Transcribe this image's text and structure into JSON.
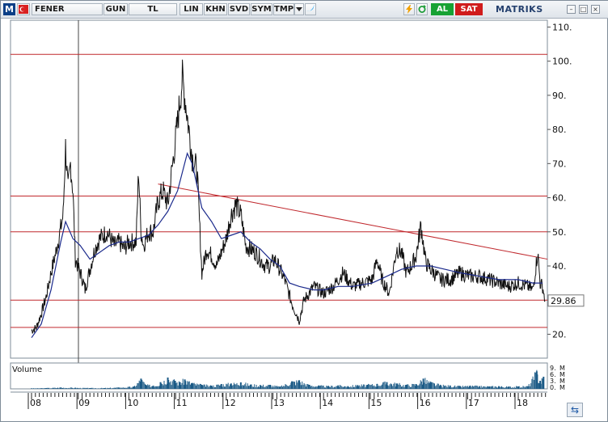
{
  "toolbar": {
    "logo": "M",
    "symbol": "FENER",
    "period": "GUN",
    "currency": "TL",
    "buttons": [
      "LIN",
      "KHN",
      "SVD",
      "SYM",
      "TMP"
    ],
    "buy": "AL",
    "sell": "SAT",
    "brand": "MATRIKS",
    "icons": [
      "flag-icon",
      "twitter-icon",
      "lightning-icon",
      "refresh-icon"
    ]
  },
  "chart_data": {
    "type": "line",
    "x_ticks": [
      "08",
      "09",
      "10",
      "11",
      "12",
      "13",
      "14",
      "15",
      "16",
      "17",
      "18"
    ],
    "y_ticks": [
      20,
      30,
      40,
      50,
      60,
      70,
      80,
      90,
      100,
      110
    ],
    "y_tick_labels": [
      "20.",
      "30.",
      "40.",
      "50.",
      "60.",
      "70.",
      "80.",
      "90.",
      "100.",
      "110."
    ],
    "ylim": [
      13,
      112
    ],
    "last_price_label": "29.86",
    "last_price": 29.86,
    "horizontal_levels": [
      22,
      30,
      50,
      60.5,
      102
    ],
    "trendline": [
      {
        "x": 10.6,
        "y": 64
      },
      {
        "x": 18.6,
        "y": 42
      }
    ],
    "price_path": [
      [
        8.0,
        21
      ],
      [
        8.1,
        22
      ],
      [
        8.2,
        26
      ],
      [
        8.3,
        31
      ],
      [
        8.4,
        38
      ],
      [
        8.5,
        44
      ],
      [
        8.6,
        51
      ],
      [
        8.65,
        55
      ],
      [
        8.7,
        75
      ],
      [
        8.75,
        62
      ],
      [
        8.8,
        70
      ],
      [
        8.85,
        62
      ],
      [
        8.9,
        42
      ],
      [
        9.0,
        38
      ],
      [
        9.05,
        36
      ],
      [
        9.1,
        33
      ],
      [
        9.2,
        39
      ],
      [
        9.3,
        45
      ],
      [
        9.4,
        48
      ],
      [
        9.55,
        50
      ],
      [
        9.7,
        46
      ],
      [
        9.8,
        47
      ],
      [
        9.9,
        45
      ],
      [
        10.0,
        47
      ],
      [
        10.15,
        47
      ],
      [
        10.2,
        68
      ],
      [
        10.25,
        50
      ],
      [
        10.3,
        46
      ],
      [
        10.4,
        50
      ],
      [
        10.5,
        50
      ],
      [
        10.6,
        59
      ],
      [
        10.7,
        62
      ],
      [
        10.8,
        58
      ],
      [
        10.9,
        70
      ],
      [
        11.0,
        82
      ],
      [
        11.1,
        95
      ],
      [
        11.2,
        84
      ],
      [
        11.3,
        72
      ],
      [
        11.4,
        68
      ],
      [
        11.5,
        38
      ],
      [
        11.6,
        45
      ],
      [
        11.7,
        43
      ],
      [
        11.8,
        40
      ],
      [
        11.9,
        44
      ],
      [
        12.0,
        48
      ],
      [
        12.1,
        55
      ],
      [
        12.2,
        58
      ],
      [
        12.3,
        55
      ],
      [
        12.4,
        46
      ],
      [
        12.5,
        45
      ],
      [
        12.6,
        44
      ],
      [
        12.7,
        42
      ],
      [
        12.8,
        40
      ],
      [
        12.9,
        40
      ],
      [
        13.0,
        42
      ],
      [
        13.2,
        36
      ],
      [
        13.35,
        29
      ],
      [
        13.5,
        24
      ],
      [
        13.6,
        30
      ],
      [
        13.8,
        34
      ],
      [
        14.0,
        32
      ],
      [
        14.2,
        34
      ],
      [
        14.4,
        38
      ],
      [
        14.6,
        34
      ],
      [
        14.8,
        35
      ],
      [
        15.0,
        36
      ],
      [
        15.1,
        42
      ],
      [
        15.2,
        36
      ],
      [
        15.35,
        32
      ],
      [
        15.5,
        45
      ],
      [
        15.6,
        44
      ],
      [
        15.7,
        38
      ],
      [
        15.8,
        40
      ],
      [
        15.9,
        43
      ],
      [
        16.0,
        52
      ],
      [
        16.1,
        41
      ],
      [
        16.2,
        39
      ],
      [
        16.4,
        36
      ],
      [
        16.6,
        36
      ],
      [
        16.8,
        38
      ],
      [
        17.0,
        37
      ],
      [
        17.2,
        37
      ],
      [
        17.4,
        36
      ],
      [
        17.6,
        35
      ],
      [
        17.8,
        34
      ],
      [
        18.0,
        35
      ],
      [
        18.2,
        34
      ],
      [
        18.3,
        33
      ],
      [
        18.4,
        44
      ],
      [
        18.45,
        35
      ],
      [
        18.5,
        34
      ],
      [
        18.55,
        29.86
      ]
    ],
    "ma_path": [
      [
        8.0,
        19
      ],
      [
        8.2,
        23
      ],
      [
        8.4,
        33
      ],
      [
        8.6,
        47
      ],
      [
        8.7,
        53
      ],
      [
        8.85,
        48
      ],
      [
        9.0,
        46
      ],
      [
        9.2,
        42
      ],
      [
        9.4,
        44
      ],
      [
        9.6,
        46
      ],
      [
        9.8,
        47
      ],
      [
        10.0,
        47
      ],
      [
        10.2,
        48
      ],
      [
        10.4,
        49
      ],
      [
        10.6,
        52
      ],
      [
        10.8,
        56
      ],
      [
        11.0,
        62
      ],
      [
        11.2,
        73
      ],
      [
        11.3,
        70
      ],
      [
        11.5,
        57
      ],
      [
        11.7,
        53
      ],
      [
        11.9,
        48
      ],
      [
        12.1,
        49
      ],
      [
        12.3,
        50
      ],
      [
        12.5,
        47
      ],
      [
        12.7,
        45
      ],
      [
        12.9,
        42
      ],
      [
        13.1,
        40
      ],
      [
        13.3,
        35
      ],
      [
        13.5,
        34
      ],
      [
        13.8,
        33
      ],
      [
        14.0,
        33
      ],
      [
        14.3,
        34
      ],
      [
        14.6,
        34
      ],
      [
        15.0,
        35
      ],
      [
        15.3,
        37
      ],
      [
        15.6,
        39
      ],
      [
        15.9,
        40
      ],
      [
        16.2,
        40
      ],
      [
        16.5,
        39
      ],
      [
        16.8,
        38
      ],
      [
        17.2,
        37
      ],
      [
        17.6,
        36
      ],
      [
        18.0,
        36
      ],
      [
        18.3,
        35
      ],
      [
        18.5,
        35
      ]
    ],
    "volume": {
      "label": "Volume",
      "scale_labels": [
        "9.",
        "6.",
        "3.",
        "0."
      ],
      "unit": "M",
      "bars": [
        [
          8.0,
          0.2
        ],
        [
          8.3,
          0.3
        ],
        [
          8.6,
          0.5
        ],
        [
          8.9,
          0.4
        ],
        [
          9.2,
          0.3
        ],
        [
          9.5,
          0.3
        ],
        [
          9.8,
          0.5
        ],
        [
          10.1,
          0.8
        ],
        [
          10.25,
          3.8
        ],
        [
          10.35,
          1.5
        ],
        [
          10.5,
          1.2
        ],
        [
          10.65,
          2.5
        ],
        [
          10.8,
          4.2
        ],
        [
          10.95,
          3.0
        ],
        [
          11.05,
          2.5
        ],
        [
          11.15,
          3.5
        ],
        [
          11.3,
          2.2
        ],
        [
          11.5,
          1.5
        ],
        [
          11.7,
          1.2
        ],
        [
          11.9,
          1.8
        ],
        [
          12.1,
          2.0
        ],
        [
          12.3,
          2.4
        ],
        [
          12.5,
          1.6
        ],
        [
          12.7,
          1.4
        ],
        [
          12.9,
          1.5
        ],
        [
          13.1,
          0.8
        ],
        [
          13.35,
          2.8
        ],
        [
          13.5,
          3.2
        ],
        [
          13.7,
          1.5
        ],
        [
          13.9,
          1.2
        ],
        [
          14.1,
          1.0
        ],
        [
          14.3,
          1.3
        ],
        [
          14.5,
          1.0
        ],
        [
          14.7,
          1.4
        ],
        [
          14.9,
          1.5
        ],
        [
          15.1,
          1.8
        ],
        [
          15.3,
          2.5
        ],
        [
          15.5,
          2.0
        ],
        [
          15.7,
          1.5
        ],
        [
          15.9,
          1.8
        ],
        [
          16.05,
          3.8
        ],
        [
          16.2,
          2.5
        ],
        [
          16.4,
          1.4
        ],
        [
          16.6,
          1.2
        ],
        [
          16.8,
          1.0
        ],
        [
          17.0,
          1.1
        ],
        [
          17.2,
          1.0
        ],
        [
          17.4,
          0.9
        ],
        [
          17.6,
          1.0
        ],
        [
          17.8,
          0.8
        ],
        [
          18.0,
          0.9
        ],
        [
          18.2,
          1.0
        ],
        [
          18.38,
          6.5
        ],
        [
          18.45,
          3.0
        ],
        [
          18.52,
          4.5
        ]
      ]
    }
  }
}
